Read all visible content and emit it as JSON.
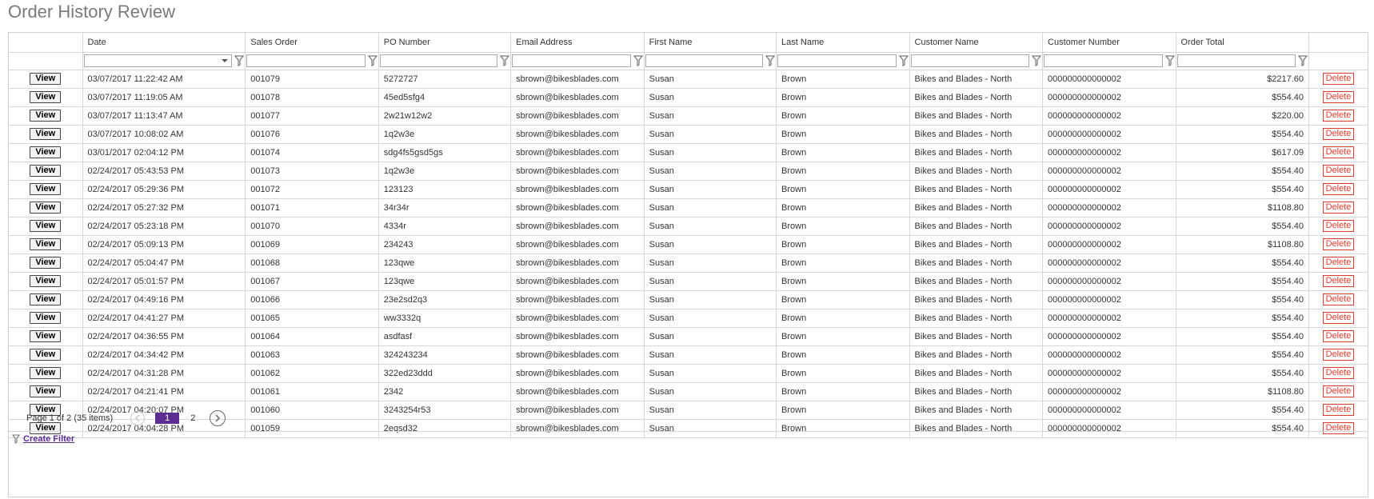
{
  "page": {
    "title": "Order History Review"
  },
  "columns": [
    "",
    "Date",
    "Sales Order",
    "PO Number",
    "Email Address",
    "First Name",
    "Last Name",
    "Customer Name",
    "Customer Number",
    "Order Total",
    ""
  ],
  "actions": {
    "view_label": "View",
    "delete_label": "Delete"
  },
  "rows": [
    [
      "03/07/2017 11:22:42 AM",
      "001079",
      "5272727",
      "sbrown@bikesblades.com",
      "Susan",
      "Brown",
      "Bikes and Blades - North",
      "000000000000002",
      "$2217.60"
    ],
    [
      "03/07/2017 11:19:05 AM",
      "001078",
      "45ed5sfg4",
      "sbrown@bikesblades.com",
      "Susan",
      "Brown",
      "Bikes and Blades - North",
      "000000000000002",
      "$554.40"
    ],
    [
      "03/07/2017 11:13:47 AM",
      "001077",
      "2w21w12w2",
      "sbrown@bikesblades.com",
      "Susan",
      "Brown",
      "Bikes and Blades - North",
      "000000000000002",
      "$220.00"
    ],
    [
      "03/07/2017 10:08:02 AM",
      "001076",
      "1q2w3e",
      "sbrown@bikesblades.com",
      "Susan",
      "Brown",
      "Bikes and Blades - North",
      "000000000000002",
      "$554.40"
    ],
    [
      "03/01/2017 02:04:12 PM",
      "001074",
      "sdg4fs5gsd5gs",
      "sbrown@bikesblades.com",
      "Susan",
      "Brown",
      "Bikes and Blades - North",
      "000000000000002",
      "$617.09"
    ],
    [
      "02/24/2017 05:43:53 PM",
      "001073",
      "1q2w3e",
      "sbrown@bikesblades.com",
      "Susan",
      "Brown",
      "Bikes and Blades - North",
      "000000000000002",
      "$554.40"
    ],
    [
      "02/24/2017 05:29:36 PM",
      "001072",
      "123123",
      "sbrown@bikesblades.com",
      "Susan",
      "Brown",
      "Bikes and Blades - North",
      "000000000000002",
      "$554.40"
    ],
    [
      "02/24/2017 05:27:32 PM",
      "001071",
      "34r34r",
      "sbrown@bikesblades.com",
      "Susan",
      "Brown",
      "Bikes and Blades - North",
      "000000000000002",
      "$1108.80"
    ],
    [
      "02/24/2017 05:23:18 PM",
      "001070",
      "4334r",
      "sbrown@bikesblades.com",
      "Susan",
      "Brown",
      "Bikes and Blades - North",
      "000000000000002",
      "$554.40"
    ],
    [
      "02/24/2017 05:09:13 PM",
      "001069",
      "234243",
      "sbrown@bikesblades.com",
      "Susan",
      "Brown",
      "Bikes and Blades - North",
      "000000000000002",
      "$1108.80"
    ],
    [
      "02/24/2017 05:04:47 PM",
      "001068",
      "123qwe",
      "sbrown@bikesblades.com",
      "Susan",
      "Brown",
      "Bikes and Blades - North",
      "000000000000002",
      "$554.40"
    ],
    [
      "02/24/2017 05:01:57 PM",
      "001067",
      "123qwe",
      "sbrown@bikesblades.com",
      "Susan",
      "Brown",
      "Bikes and Blades - North",
      "000000000000002",
      "$554.40"
    ],
    [
      "02/24/2017 04:49:16 PM",
      "001066",
      "23e2sd2q3",
      "sbrown@bikesblades.com",
      "Susan",
      "Brown",
      "Bikes and Blades - North",
      "000000000000002",
      "$554.40"
    ],
    [
      "02/24/2017 04:41:27 PM",
      "001065",
      "ww3332q",
      "sbrown@bikesblades.com",
      "Susan",
      "Brown",
      "Bikes and Blades - North",
      "000000000000002",
      "$554.40"
    ],
    [
      "02/24/2017 04:36:55 PM",
      "001064",
      "asdfasf",
      "sbrown@bikesblades.com",
      "Susan",
      "Brown",
      "Bikes and Blades - North",
      "000000000000002",
      "$554.40"
    ],
    [
      "02/24/2017 04:34:42 PM",
      "001063",
      "324243234",
      "sbrown@bikesblades.com",
      "Susan",
      "Brown",
      "Bikes and Blades - North",
      "000000000000002",
      "$554.40"
    ],
    [
      "02/24/2017 04:31:28 PM",
      "001062",
      "322ed23ddd",
      "sbrown@bikesblades.com",
      "Susan",
      "Brown",
      "Bikes and Blades - North",
      "000000000000002",
      "$554.40"
    ],
    [
      "02/24/2017 04:21:41 PM",
      "001061",
      "2342",
      "sbrown@bikesblades.com",
      "Susan",
      "Brown",
      "Bikes and Blades - North",
      "000000000000002",
      "$1108.80"
    ],
    [
      "02/24/2017 04:20:07 PM",
      "001060",
      "3243254r53",
      "sbrown@bikesblades.com",
      "Susan",
      "Brown",
      "Bikes and Blades - North",
      "000000000000002",
      "$554.40"
    ],
    [
      "02/24/2017 04:04:28 PM",
      "001059",
      "2eqsd32",
      "sbrown@bikesblades.com",
      "Susan",
      "Brown",
      "Bikes and Blades - North",
      "000000000000002",
      "$554.40"
    ]
  ],
  "pager": {
    "summary": "Page 1 of 2 (35 items)",
    "current_page": "1",
    "other_page": "2",
    "prev_icon": "chevron-left-icon",
    "next_icon": "chevron-right-icon"
  },
  "footer": {
    "create_filter_label": "Create Filter",
    "icon": "filter-icon"
  },
  "colors": {
    "accent": "#5c2d91",
    "delete": "#e03c2c",
    "title": "#7a7a7a",
    "border": "#d7d7d7"
  }
}
